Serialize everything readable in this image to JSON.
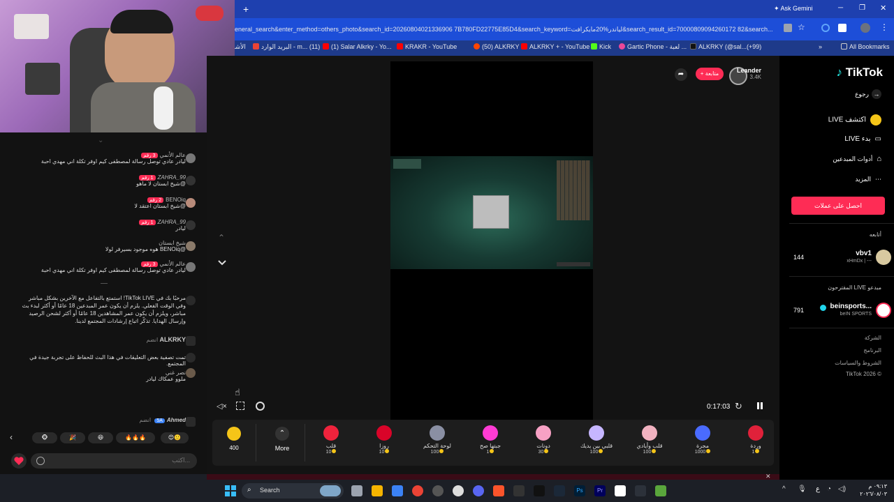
{
  "browser": {
    "ask_gemini": "Ask Gemini",
    "url": "eneral_search&enter_method=others_photo&search_id=20260804021336906 7B780FD22775E85D4&search_keyword=لياندر%20مايكرافت&search_result_id=70000809094260172 82&search...",
    "bookmarks": [
      {
        "label": "الأشا",
        "color": "#9ca3af"
      },
      {
        "label": "البريد الوارد - m... (11)",
        "color": "#ea4335"
      },
      {
        "label": "(1) Salar Alkrky - Yo...",
        "color": "#ff0000"
      },
      {
        "label": "KRAKR - YouTube",
        "color": "#ff0000"
      },
      {
        "label": "(50) ALKRKY",
        "color": "#ff4500"
      },
      {
        "label": "ALKRKY + - YouTube",
        "color": "#ff0000"
      },
      {
        "label": "Kick",
        "color": "#53fc18"
      },
      {
        "label": "Gartic Phone - لعبة ...",
        "color": "#ec4899"
      },
      {
        "label": "ALKRKY (@sal...(+99)",
        "color": "#000000"
      }
    ],
    "all_bookmarks": "All Bookmarks"
  },
  "chat": {
    "messages": [
      {
        "user": "عالم الأنمي",
        "badge": "3 رقم",
        "text": "ليادر عادي توصل رسالة لمصطفى كيم اوفر تكلة اني مهدي احبة"
      },
      {
        "user": "ZAHRA_99",
        "badge": "1 رقم",
        "text": "@شيخ ابستان لا ماهو"
      },
      {
        "user": "BENOiq",
        "badge": "2 رقم",
        "text": "@شيخ ابستان اعتقد لا"
      },
      {
        "user": "ZAHRA_99",
        "badge": "1 رقم",
        "text": "ليادر"
      },
      {
        "user": "شيخ ابستان",
        "badge": "",
        "text": "@BENOiq هوه موجود بسيرفر لولا"
      },
      {
        "user": "عالم الأنمي",
        "badge": "3 رقم",
        "text": "ليادر عادي توصل رسالة لمصطفى كيم اوفر تكلة اني مهدي احبة"
      }
    ],
    "notice": "مرحبًا بك في TikTok LIVE! استمتع بالتفاعل مع الآخرين بشكل مباشر وفي الوقت الفعلي. يلزم أن يكون عمر المبدعين 18 عامًا أو أكثر لبدء بث مباشر، ويلزم أن يكون عمر المشاهدين 18 عامًا أو أكثر لشحن الرصيد وإرسال الهدايا. تذكّر اتباع إرشادات المجتمع لدينا.",
    "joined_user": "ALKRKY",
    "joined_label": "انضم",
    "moderation": "تمت تصفية بعض التعليقات في هذا البث للحفاظ على تجربة جيدة في المجتمع.",
    "last_user": "نصر غني",
    "last_text": "ملوو عمكاك ليادر",
    "bottom_user": "Ahmed",
    "bottom_badge": "5A",
    "bottom_label": "انضم",
    "input_placeholder": "اكتب...",
    "quick_emojis": [
      "😊🙂",
      "🔥🔥🔥",
      "😆",
      "🎉",
      "🐵"
    ]
  },
  "stream": {
    "streamer": "Leander",
    "viewers": "3.4K",
    "follow_label": "+ متابعة",
    "time": "0:17:03"
  },
  "gifts": {
    "coins": "400",
    "more": "More",
    "items": [
      {
        "name": "قلب",
        "price": "10",
        "color": "#ef233c"
      },
      {
        "name": "روزا",
        "price": "10",
        "color": "#d90429"
      },
      {
        "name": "لوحة التحكم",
        "price": "100",
        "color": "#8a8fa3"
      },
      {
        "name": "جبتها صح",
        "price": "1",
        "color": "#ff3bd4"
      },
      {
        "name": "دونات",
        "price": "30",
        "color": "#f7a1c4"
      },
      {
        "name": "قلبي بين يديك",
        "price": "100",
        "color": "#c6b6ff"
      },
      {
        "name": "قلب وأيادي",
        "price": "100",
        "color": "#f1b2c0"
      },
      {
        "name": "مجرة",
        "price": "1000",
        "color": "#4a6bff"
      },
      {
        "name": "وردة",
        "price": "1",
        "color": "#e0213a"
      }
    ]
  },
  "sidebar": {
    "logo": "TikTok",
    "back": "رجوع",
    "explore_live": "اكتشف LIVE",
    "start_live": "بدء LIVE",
    "creator_tools": "أدوات المبدعين",
    "more": "المزيد",
    "coins_button": "احصل على عملات",
    "following_title": "أتابعه",
    "following": [
      {
        "name": "vbv1",
        "sub": "xHmDx | ---",
        "count": "144"
      }
    ],
    "recommended_title": "مبدعو LIVE المقترحون",
    "recommended": [
      {
        "name": "beinsports...",
        "sub": "beIN SPORTS",
        "count": "791"
      }
    ],
    "footer": [
      "الشركة",
      "البرنامج",
      "الشروط والسياسات",
      "© TikTok 2026"
    ]
  },
  "taskbar": {
    "search": "Search",
    "time": "٠٩:١٣ م",
    "date": "٢٠٢٦/٠٨/٠٣",
    "lang": "ع"
  }
}
